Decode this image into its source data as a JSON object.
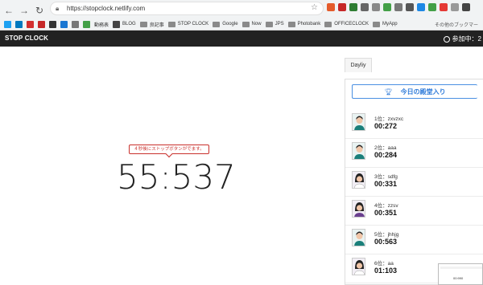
{
  "browser": {
    "url": "https://stopclock.netlify.com",
    "bookmarks": [
      "動務表",
      "BLOG",
      "良記事",
      "STOP CLOCK",
      "Google",
      "Now",
      "JPS",
      "Photobank",
      "OFFICECLOCK",
      "MyApp"
    ],
    "bookmarks_right": "その他のブックマー"
  },
  "app": {
    "brand": "STOP CLOCK",
    "online_label": "参加中：2"
  },
  "stopwatch": {
    "tooltip": "４秒後にストップボタンがでます。",
    "time": "55:537"
  },
  "leaderboard": {
    "tab": "Dayliy",
    "title": "今日の殿堂入り",
    "entries": [
      {
        "rank_name": "1位：zxvzxc",
        "time": "00:272",
        "avatar": "male"
      },
      {
        "rank_name": "2位：aaa",
        "time": "00:284",
        "avatar": "male"
      },
      {
        "rank_name": "3位：sdfg",
        "time": "00:331",
        "avatar": "female"
      },
      {
        "rank_name": "4位：zzsv",
        "time": "00:351",
        "avatar": "female"
      },
      {
        "rank_name": "5位：jhhjg",
        "time": "00:563",
        "avatar": "male"
      },
      {
        "rank_name": "6位：aa",
        "time": "01:103",
        "avatar": "female"
      }
    ]
  },
  "thumbnail": {
    "text": "00:990"
  },
  "colors": {
    "accent": "#2f7bd9",
    "tooltip": "#c9302c",
    "appbar": "#222222"
  }
}
